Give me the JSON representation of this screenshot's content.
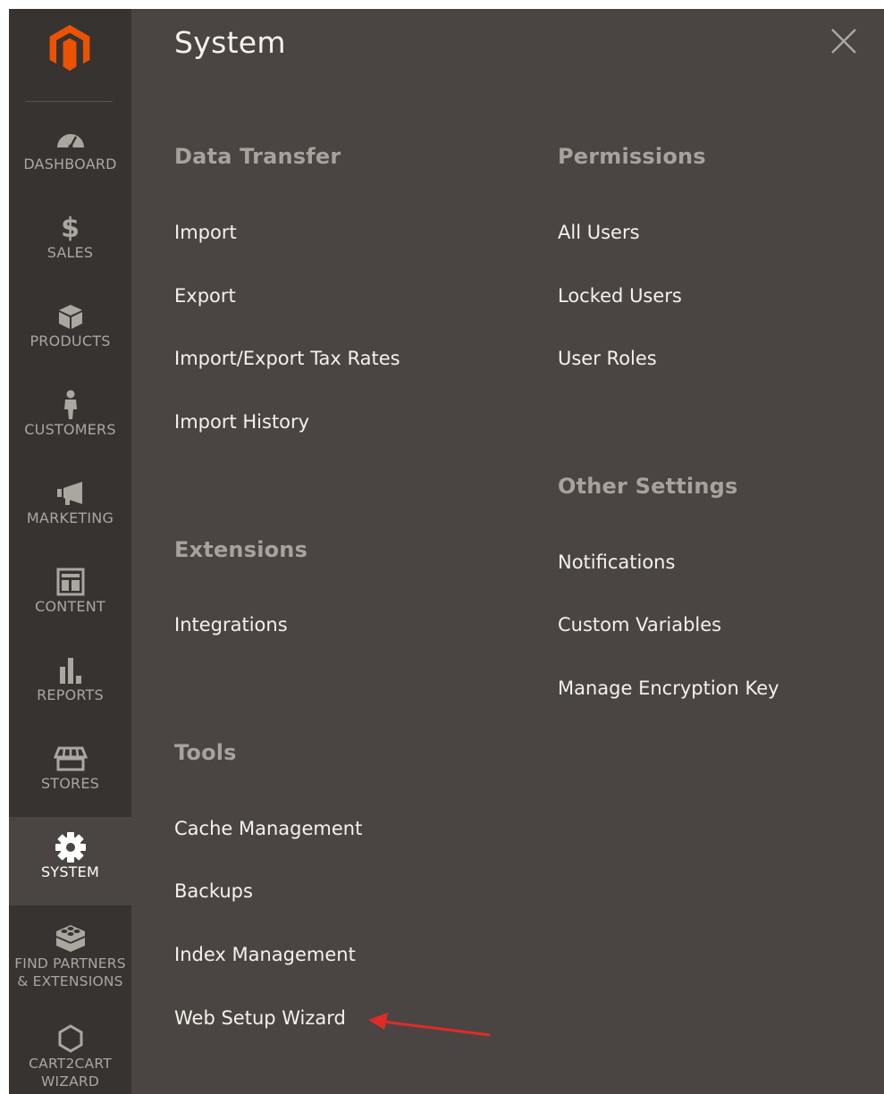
{
  "colors": {
    "panel_bg": "#4a4542",
    "sidebar_bg": "#373330",
    "brand_orange": "#eb5202",
    "annotation_arrow": "#e02b27"
  },
  "sidebar": {
    "logo_icon": "magento-logo-icon",
    "items": [
      {
        "label": "DASHBOARD",
        "icon": "speedometer-icon"
      },
      {
        "label": "SALES",
        "icon": "dollar-icon"
      },
      {
        "label": "PRODUCTS",
        "icon": "box-icon"
      },
      {
        "label": "CUSTOMERS",
        "icon": "person-icon"
      },
      {
        "label": "MARKETING",
        "icon": "megaphone-icon"
      },
      {
        "label": "CONTENT",
        "icon": "layout-icon"
      },
      {
        "label": "REPORTS",
        "icon": "bar-chart-icon"
      },
      {
        "label": "STORES",
        "icon": "storefront-icon"
      },
      {
        "label": "SYSTEM",
        "icon": "gear-icon",
        "active": true
      },
      {
        "label": "FIND PARTNERS",
        "label2": "& EXTENSIONS",
        "icon": "blocks-icon"
      },
      {
        "label": "CART2CART",
        "label2": "WIZARD",
        "icon": "hexagon-icon"
      }
    ]
  },
  "panel": {
    "title": "System",
    "close_icon": "close-icon",
    "sections": {
      "data_transfer": {
        "title": "Data Transfer",
        "links": [
          "Import",
          "Export",
          "Import/Export Tax Rates",
          "Import History"
        ]
      },
      "extensions": {
        "title": "Extensions",
        "links": [
          "Integrations"
        ]
      },
      "tools": {
        "title": "Tools",
        "links": [
          "Cache Management",
          "Backups",
          "Index Management",
          "Web Setup Wizard"
        ]
      },
      "permissions": {
        "title": "Permissions",
        "links": [
          "All Users",
          "Locked Users",
          "User Roles"
        ]
      },
      "other_settings": {
        "title": "Other Settings",
        "links": [
          "Notifications",
          "Custom Variables",
          "Manage Encryption Key"
        ]
      }
    }
  }
}
